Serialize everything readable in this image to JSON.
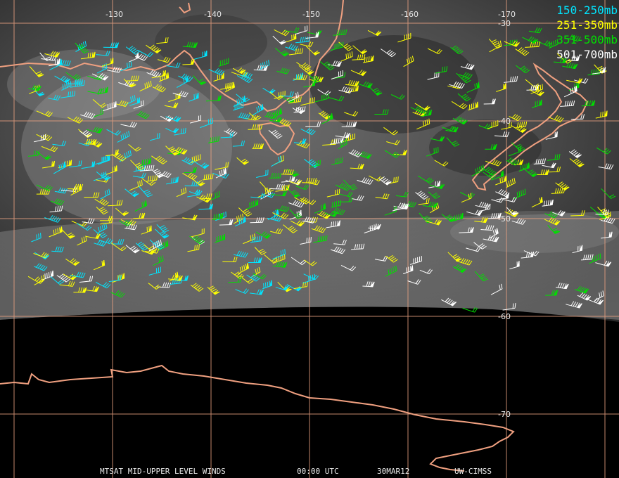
{
  "legend": [
    {
      "label": "150-250mb",
      "color": "#00e5ff"
    },
    {
      "label": "251-350mb",
      "color": "#ffff00"
    },
    {
      "label": "351-500mb",
      "color": "#00e000"
    },
    {
      "label": "501-700mb",
      "color": "#ffffff"
    }
  ],
  "longitude_labels": [
    "-130",
    "-140",
    "-150",
    "-160",
    "-170"
  ],
  "latitude_labels": [
    "-30",
    "-40",
    "-50",
    "-60",
    "-70"
  ],
  "footer": {
    "product": "MTSAT MID-UPPER LEVEL WINDS",
    "time": "00:00 UTC",
    "date": "30MAR12",
    "source": "UW-CIMSS"
  },
  "colors": {
    "grid": "#e8a080",
    "coast": "#f0a080",
    "space": "#000000"
  }
}
